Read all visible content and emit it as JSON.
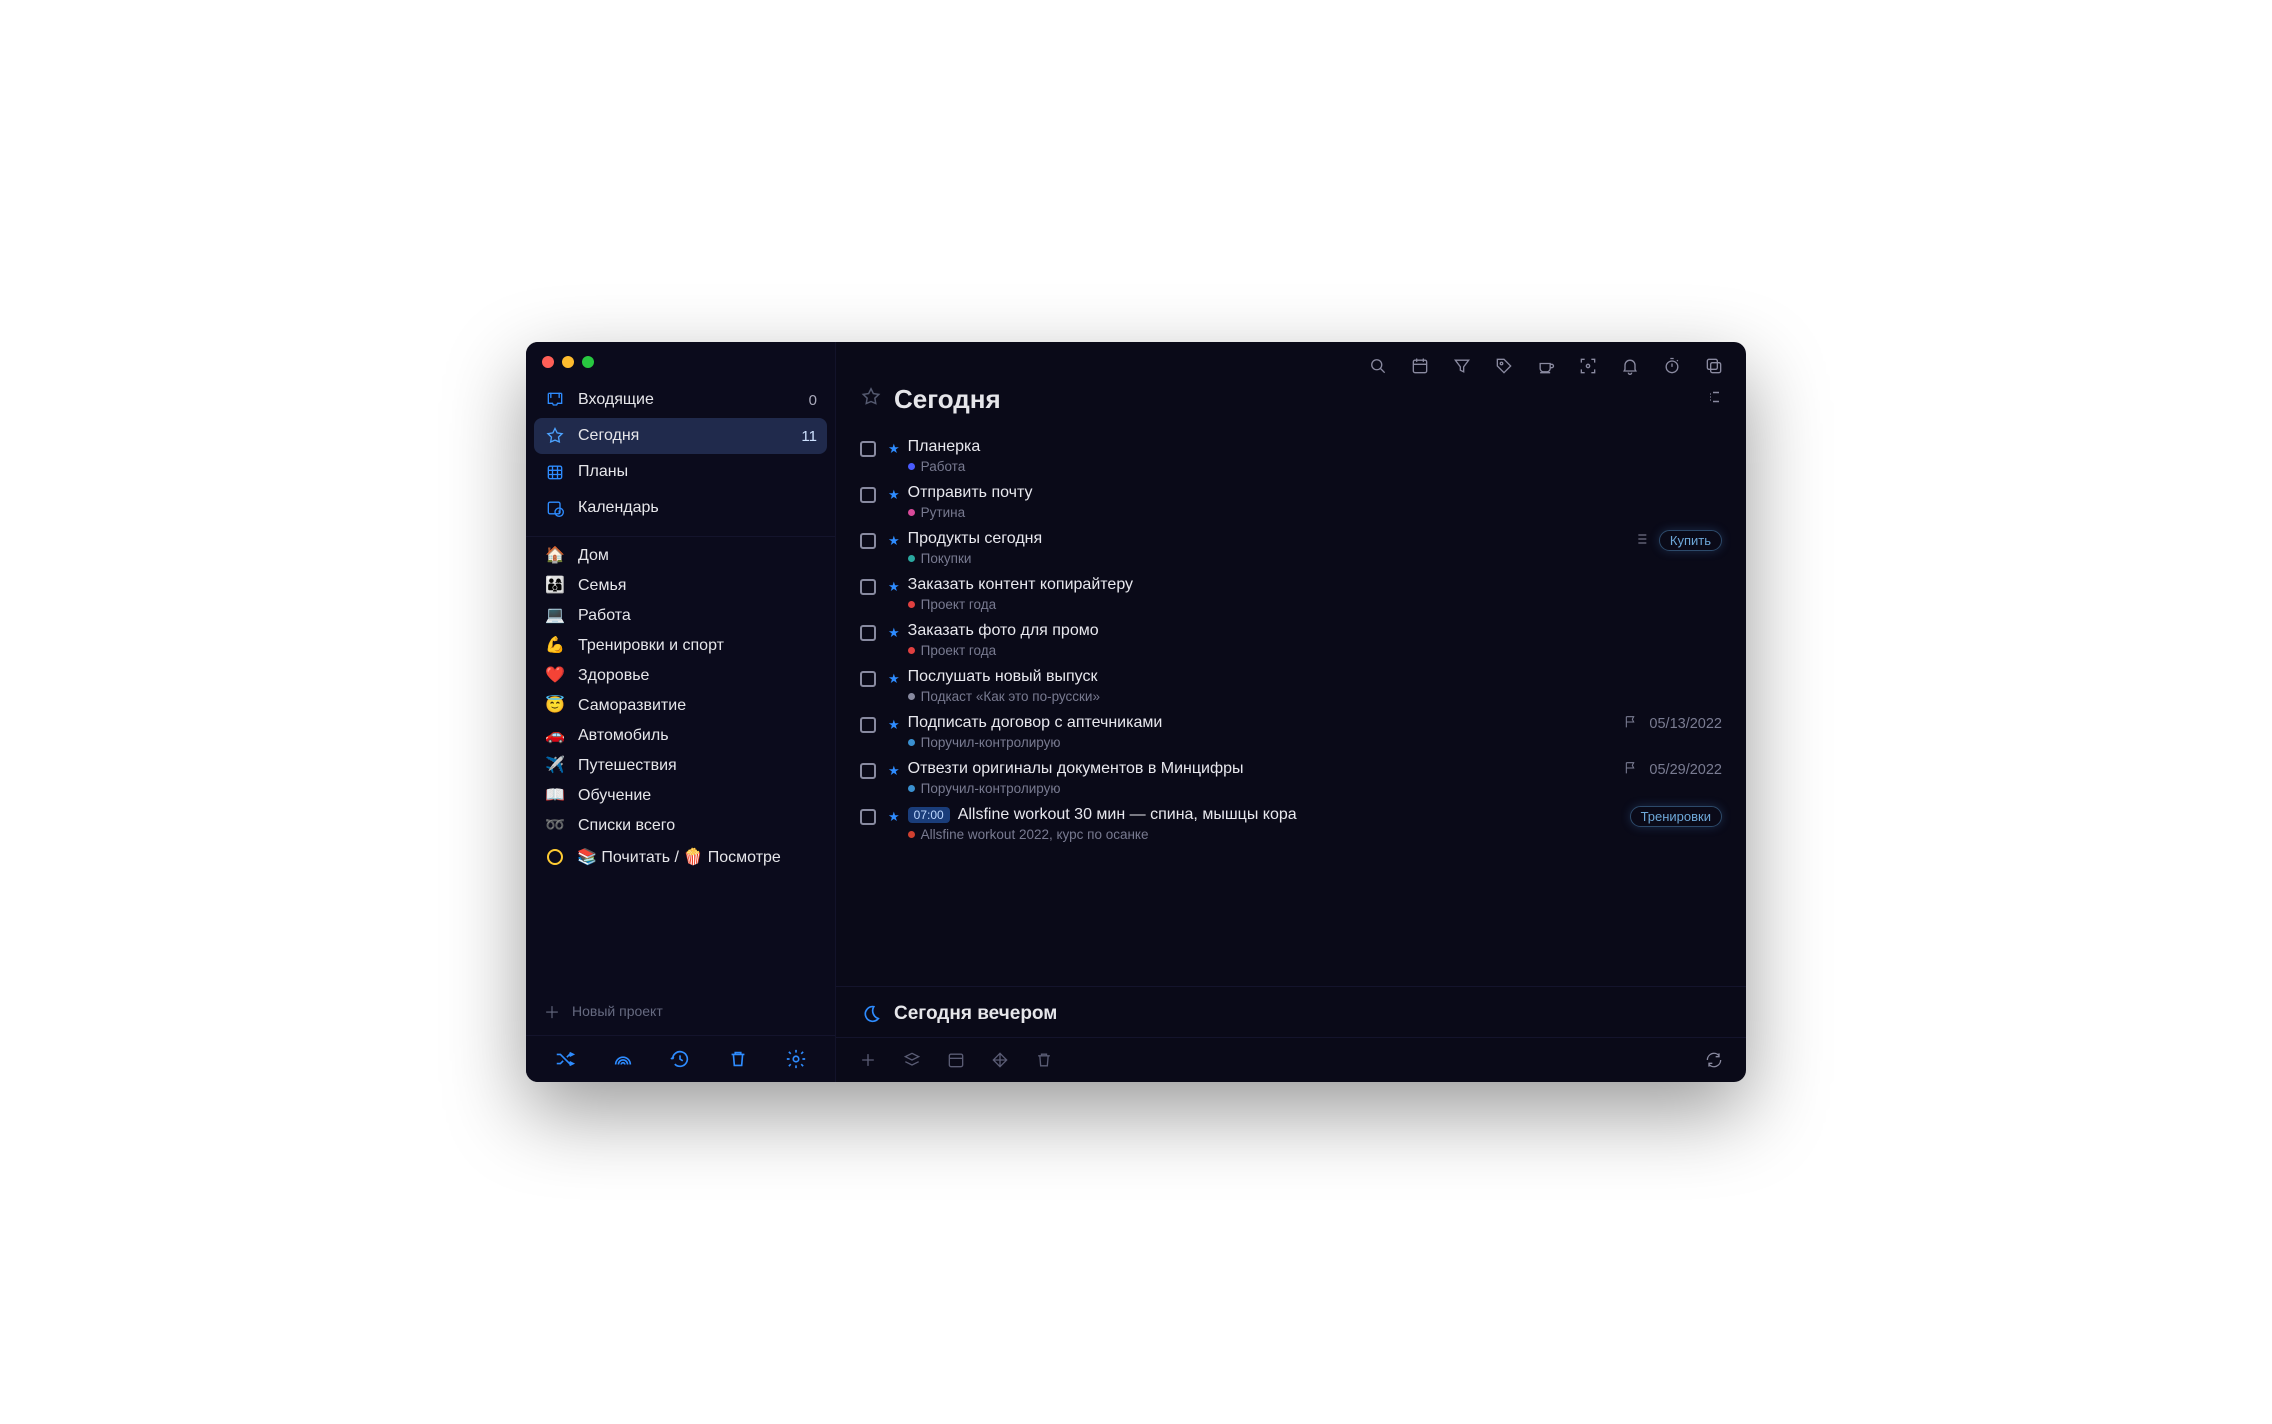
{
  "nav": [
    {
      "label": "Входящие",
      "count": "0"
    },
    {
      "label": "Сегодня",
      "count": "11"
    },
    {
      "label": "Планы",
      "count": ""
    },
    {
      "label": "Календарь",
      "count": ""
    }
  ],
  "projects": [
    {
      "emoji": "🏠",
      "label": "Дом"
    },
    {
      "emoji": "👨‍👩‍👦",
      "label": "Семья"
    },
    {
      "emoji": "💻",
      "label": "Работа"
    },
    {
      "emoji": "💪",
      "label": "Тренировки и спорт"
    },
    {
      "emoji": "❤️",
      "label": "Здоровье"
    },
    {
      "emoji": "😇",
      "label": "Саморазвитие"
    },
    {
      "emoji": "🚗",
      "label": "Автомобиль"
    },
    {
      "emoji": "✈️",
      "label": "Путешествия"
    },
    {
      "emoji": "📖",
      "label": "Обучение"
    },
    {
      "emoji": "➿",
      "label": "Списки всего"
    }
  ],
  "special_project": {
    "emoji": "📚 Почитать / 🍿 Посмотре"
  },
  "new_project_label": "Новый проект",
  "page_title": "Сегодня",
  "tasks": [
    {
      "title": "Планерка",
      "sub": "Работа",
      "dot": "blue"
    },
    {
      "title": "Отправить почту",
      "sub": "Рутина",
      "dot": "pink"
    },
    {
      "title": "Продукты сегодня",
      "sub": "Покупки",
      "dot": "teal",
      "buy": "Купить",
      "hasList": true
    },
    {
      "title": "Заказать контент копирайтеру",
      "sub": "Проект года",
      "dot": "red"
    },
    {
      "title": "Заказать фото для промо",
      "sub": "Проект года",
      "dot": "red"
    },
    {
      "title": "Послушать новый выпуск",
      "sub": "Подкаст «Как это по-русски»",
      "dot": "grey"
    },
    {
      "title": "Подписать договор с аптечниками",
      "sub": "Поручил-контролирую",
      "dot": "cyan",
      "date": "05/13/2022"
    },
    {
      "title": "Отвезти оригиналы документов в Минцифры",
      "sub": "Поручил-контролирую",
      "dot": "cyan",
      "date": "05/29/2022"
    },
    {
      "title": "Allsfine workout 30 мин — спина, мышцы кора",
      "sub": "Allsfine workout 2022, курс по осанке",
      "dot": "red2",
      "time": "07:00",
      "badge": "Тренировки"
    }
  ],
  "evening_title": "Сегодня вечером"
}
